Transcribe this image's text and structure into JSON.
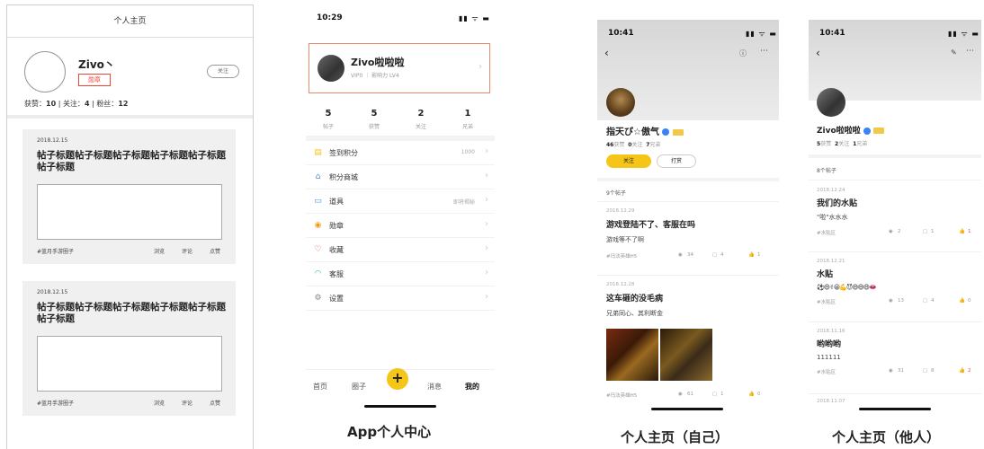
{
  "wireframe": {
    "header": "个人主页",
    "username": "Zivo丶",
    "badge": "勋章",
    "follow": "关注",
    "stats": {
      "likes_label": "获赞：",
      "likes": "10",
      "follow_label": "关注：",
      "follow": "4",
      "fans_label": "粉丝：",
      "fans": "12"
    },
    "cards": [
      {
        "date": "2018.12.15",
        "title": "帖子标题帖子标题帖子标题帖子标题帖子标题帖子标题",
        "circle": "#蓝月手游圈子",
        "browse": "浏览",
        "comment": "评论",
        "like": "点赞"
      },
      {
        "date": "2018.12.15",
        "title": "帖子标题帖子标题帖子标题帖子标题帖子标题帖子标题",
        "circle": "#蓝月手游圈子",
        "browse": "浏览",
        "comment": "评论",
        "like": "点赞"
      }
    ]
  },
  "center": {
    "time": "10:29",
    "signal": "▮▮ ᯤ ▬",
    "name": "Zivo啦啦啦",
    "vip": "VIP0 ｜ 影响力 LV4",
    "stats": [
      {
        "num": "5",
        "label": "帖子"
      },
      {
        "num": "5",
        "label": "获赞"
      },
      {
        "num": "2",
        "label": "关注"
      },
      {
        "num": "1",
        "label": "兄弟"
      }
    ],
    "menu": [
      {
        "icon": "coin-icon",
        "glyph": "▤",
        "color": "#f5c518",
        "label": "签到积分",
        "right": "1000"
      },
      {
        "icon": "shop-icon",
        "glyph": "⌂",
        "color": "#4a90e2",
        "label": "积分商城",
        "right": ""
      },
      {
        "icon": "bag-icon",
        "glyph": "▭",
        "color": "#4a90e2",
        "label": "道具",
        "right": "即将揭秘"
      },
      {
        "icon": "medal-icon",
        "glyph": "◉",
        "color": "#f39c12",
        "label": "勋章",
        "right": ""
      },
      {
        "icon": "heart-icon",
        "glyph": "♡",
        "color": "#e74c3c",
        "label": "收藏",
        "right": ""
      },
      {
        "icon": "headset-icon",
        "glyph": "◠",
        "color": "#1abc9c",
        "label": "客服",
        "right": ""
      },
      {
        "icon": "gear-icon",
        "glyph": "⚙",
        "color": "#888888",
        "label": "设置",
        "right": ""
      }
    ],
    "tabs": {
      "home": "首页",
      "circle": "圈子",
      "message": "消息",
      "mine": "我的",
      "plus": "+"
    },
    "caption": "App个人中心"
  },
  "self": {
    "time": "10:41",
    "name": "指天ぴ☆傲气",
    "stats": {
      "posts": "46",
      "posts_label": "获赞",
      "follow": "0",
      "follow_label": "关注",
      "bro": "7",
      "bro_label": "兄弟"
    },
    "follow_btn": "关注",
    "reward_btn": "打赏",
    "posts_count": "9个帖子",
    "posts": [
      {
        "date": "2018.12.29",
        "title": "游戏登陆不了、客服在吗",
        "text": "游戏等不了啊",
        "circle": "#玛法英雄H5",
        "views": "34",
        "comments": "4",
        "likes": "1"
      },
      {
        "date": "2018.12.28",
        "title": "这车砸的没毛病",
        "text": "兄弟同心、其利断金",
        "circle": "#玛法英雄H5",
        "views": "61",
        "comments": "1",
        "likes": "0"
      }
    ],
    "caption": "个人主页（自己）"
  },
  "other": {
    "time": "10:41",
    "name": "Zivo啦啦啦",
    "stats": {
      "likes": "5",
      "likes_label": "获赞",
      "follow": "2",
      "follow_label": "关注",
      "bro": "1",
      "bro_label": "兄弟"
    },
    "posts_count": "8个帖子",
    "posts": [
      {
        "date": "2018.12.24",
        "title": "我们的水贴",
        "text": "\"啦\"水水水",
        "circle": "#水贴区",
        "views": "2",
        "comments": "1",
        "likes": "1"
      },
      {
        "date": "2018.12.21",
        "title": "水贴",
        "text": "⚽😄✌😀💪😈😄😄😄👄",
        "circle": "#水贴区",
        "views": "13",
        "comments": "4",
        "likes": "0"
      },
      {
        "date": "2018.11.16",
        "title": "哟哟哟",
        "text": "111111",
        "circle": "#水贴区",
        "views": "31",
        "comments": "8",
        "likes": "2"
      },
      {
        "date": "2018.11.07",
        "title": "",
        "text": "",
        "circle": "",
        "views": "",
        "comments": "",
        "likes": ""
      }
    ],
    "caption": "个人主页（他人）"
  }
}
